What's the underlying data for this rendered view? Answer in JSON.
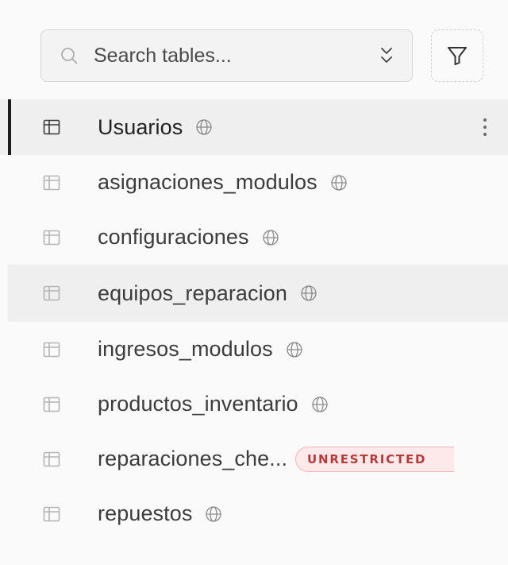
{
  "search": {
    "placeholder": "Search tables...",
    "value": ""
  },
  "icons": {
    "search": "search-icon",
    "sort": "chevrons-up-down-icon",
    "filter": "filter-funnel-icon",
    "table": "table-grid-icon",
    "globe": "globe-icon",
    "more": "more-vertical-icon"
  },
  "colors": {
    "active_indicator": "#1c1c1c",
    "badge_bg": "#fde9e9",
    "badge_border": "#f1b7b7",
    "badge_text": "#b83a3a",
    "row_highlight": "#efefef"
  },
  "tables": [
    {
      "name": "Usuarios",
      "public": true,
      "active": true
    },
    {
      "name": "asignaciones_modulos",
      "public": true
    },
    {
      "name": "configuraciones",
      "public": true
    },
    {
      "name": "equipos_reparacion",
      "public": true,
      "hover": true
    },
    {
      "name": "ingresos_modulos",
      "public": true
    },
    {
      "name": "productos_inventario",
      "public": true
    },
    {
      "name": "reparaciones_che...",
      "public": false,
      "badge": "UNRESTRICTED"
    },
    {
      "name": "repuestos",
      "public": true
    }
  ]
}
